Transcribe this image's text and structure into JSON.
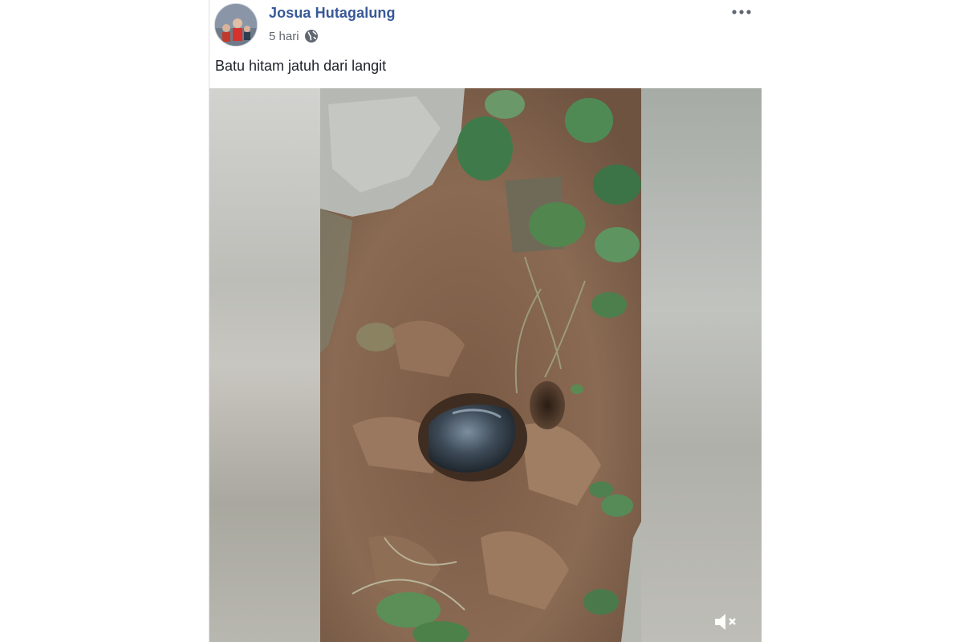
{
  "post": {
    "author": "Josua Hutagalung",
    "time": "5 hari",
    "privacy_icon": "globe-icon",
    "more_icon": "more-options-icon",
    "text": "Batu hitam jatuh dari langit"
  },
  "video": {
    "mute_icon": "mute-speaker-icon"
  },
  "colors": {
    "author_link": "#385898",
    "meta_text": "#616770",
    "body_text": "#1d2129",
    "border": "#dddfe2"
  }
}
